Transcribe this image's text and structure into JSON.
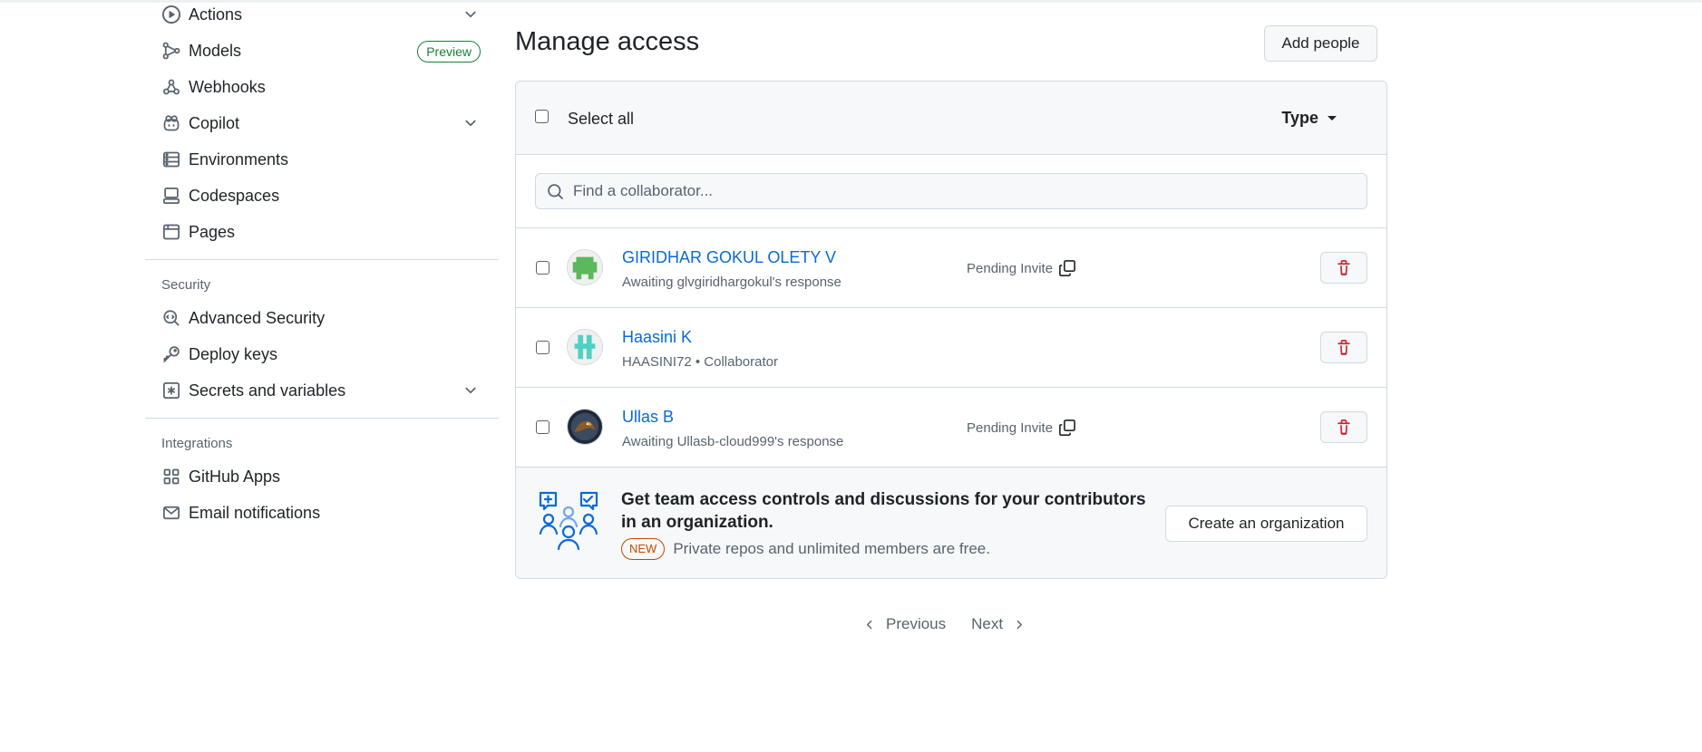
{
  "sidebar": {
    "items_top": [
      {
        "label": "Actions",
        "icon": "play-icon",
        "chevron": true
      },
      {
        "label": "Models",
        "icon": "models-icon",
        "badge": "Preview"
      },
      {
        "label": "Webhooks",
        "icon": "webhook-icon"
      },
      {
        "label": "Copilot",
        "icon": "copilot-icon",
        "chevron": true
      },
      {
        "label": "Environments",
        "icon": "server-icon"
      },
      {
        "label": "Codespaces",
        "icon": "codespaces-icon"
      },
      {
        "label": "Pages",
        "icon": "browser-icon"
      }
    ],
    "security_heading": "Security",
    "security_items": [
      {
        "label": "Advanced Security",
        "icon": "codescan-icon"
      },
      {
        "label": "Deploy keys",
        "icon": "key-icon"
      },
      {
        "label": "Secrets and variables",
        "icon": "asterisk-icon",
        "chevron": true
      }
    ],
    "integrations_heading": "Integrations",
    "integration_items": [
      {
        "label": "GitHub Apps",
        "icon": "apps-icon"
      },
      {
        "label": "Email notifications",
        "icon": "mail-icon"
      }
    ]
  },
  "main": {
    "title": "Manage access",
    "add_people_label": "Add people",
    "select_all_label": "Select all",
    "type_filter_label": "Type",
    "search_placeholder": "Find a collaborator...",
    "members": [
      {
        "name": "GIRIDHAR GOKUL OLETY V",
        "sub": "Awaiting glvgiridhargokul's response",
        "status": "Pending Invite"
      },
      {
        "name": "Haasini K",
        "sub": "HAASINI72 • Collaborator",
        "status": ""
      },
      {
        "name": "Ullas B",
        "sub": "Awaiting Ullasb-cloud999's response",
        "status": "Pending Invite"
      }
    ],
    "promo": {
      "title": "Get team access controls and discussions for your contributors in an organization.",
      "badge": "NEW",
      "text": "Private repos and unlimited members are free.",
      "button_label": "Create an organization"
    },
    "pagination": {
      "previous": "Previous",
      "next": "Next"
    }
  },
  "colors": {
    "link": "#0969da",
    "danger": "#d1242f",
    "success": "#1a7f37",
    "attention": "#bc4c00",
    "border": "#d1d9e0",
    "muted": "#59636e"
  }
}
